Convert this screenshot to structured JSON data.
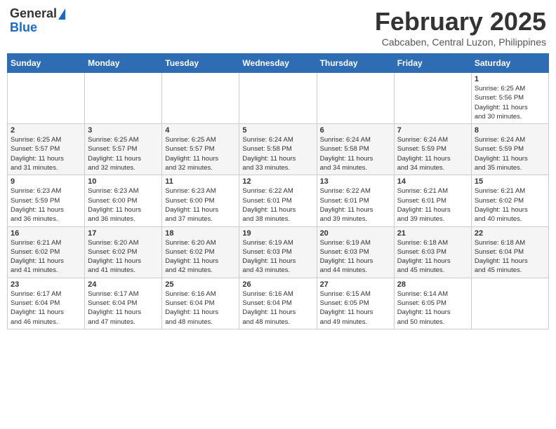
{
  "header": {
    "logo_general": "General",
    "logo_blue": "Blue",
    "month": "February 2025",
    "location": "Cabcaben, Central Luzon, Philippines"
  },
  "days_of_week": [
    "Sunday",
    "Monday",
    "Tuesday",
    "Wednesday",
    "Thursday",
    "Friday",
    "Saturday"
  ],
  "weeks": [
    [
      {
        "day": "",
        "info": ""
      },
      {
        "day": "",
        "info": ""
      },
      {
        "day": "",
        "info": ""
      },
      {
        "day": "",
        "info": ""
      },
      {
        "day": "",
        "info": ""
      },
      {
        "day": "",
        "info": ""
      },
      {
        "day": "1",
        "info": "Sunrise: 6:25 AM\nSunset: 5:56 PM\nDaylight: 11 hours\nand 30 minutes."
      }
    ],
    [
      {
        "day": "2",
        "info": "Sunrise: 6:25 AM\nSunset: 5:57 PM\nDaylight: 11 hours\nand 31 minutes."
      },
      {
        "day": "3",
        "info": "Sunrise: 6:25 AM\nSunset: 5:57 PM\nDaylight: 11 hours\nand 32 minutes."
      },
      {
        "day": "4",
        "info": "Sunrise: 6:25 AM\nSunset: 5:57 PM\nDaylight: 11 hours\nand 32 minutes."
      },
      {
        "day": "5",
        "info": "Sunrise: 6:24 AM\nSunset: 5:58 PM\nDaylight: 11 hours\nand 33 minutes."
      },
      {
        "day": "6",
        "info": "Sunrise: 6:24 AM\nSunset: 5:58 PM\nDaylight: 11 hours\nand 34 minutes."
      },
      {
        "day": "7",
        "info": "Sunrise: 6:24 AM\nSunset: 5:59 PM\nDaylight: 11 hours\nand 34 minutes."
      },
      {
        "day": "8",
        "info": "Sunrise: 6:24 AM\nSunset: 5:59 PM\nDaylight: 11 hours\nand 35 minutes."
      }
    ],
    [
      {
        "day": "9",
        "info": "Sunrise: 6:23 AM\nSunset: 5:59 PM\nDaylight: 11 hours\nand 36 minutes."
      },
      {
        "day": "10",
        "info": "Sunrise: 6:23 AM\nSunset: 6:00 PM\nDaylight: 11 hours\nand 36 minutes."
      },
      {
        "day": "11",
        "info": "Sunrise: 6:23 AM\nSunset: 6:00 PM\nDaylight: 11 hours\nand 37 minutes."
      },
      {
        "day": "12",
        "info": "Sunrise: 6:22 AM\nSunset: 6:01 PM\nDaylight: 11 hours\nand 38 minutes."
      },
      {
        "day": "13",
        "info": "Sunrise: 6:22 AM\nSunset: 6:01 PM\nDaylight: 11 hours\nand 39 minutes."
      },
      {
        "day": "14",
        "info": "Sunrise: 6:21 AM\nSunset: 6:01 PM\nDaylight: 11 hours\nand 39 minutes."
      },
      {
        "day": "15",
        "info": "Sunrise: 6:21 AM\nSunset: 6:02 PM\nDaylight: 11 hours\nand 40 minutes."
      }
    ],
    [
      {
        "day": "16",
        "info": "Sunrise: 6:21 AM\nSunset: 6:02 PM\nDaylight: 11 hours\nand 41 minutes."
      },
      {
        "day": "17",
        "info": "Sunrise: 6:20 AM\nSunset: 6:02 PM\nDaylight: 11 hours\nand 41 minutes."
      },
      {
        "day": "18",
        "info": "Sunrise: 6:20 AM\nSunset: 6:02 PM\nDaylight: 11 hours\nand 42 minutes."
      },
      {
        "day": "19",
        "info": "Sunrise: 6:19 AM\nSunset: 6:03 PM\nDaylight: 11 hours\nand 43 minutes."
      },
      {
        "day": "20",
        "info": "Sunrise: 6:19 AM\nSunset: 6:03 PM\nDaylight: 11 hours\nand 44 minutes."
      },
      {
        "day": "21",
        "info": "Sunrise: 6:18 AM\nSunset: 6:03 PM\nDaylight: 11 hours\nand 45 minutes."
      },
      {
        "day": "22",
        "info": "Sunrise: 6:18 AM\nSunset: 6:04 PM\nDaylight: 11 hours\nand 45 minutes."
      }
    ],
    [
      {
        "day": "23",
        "info": "Sunrise: 6:17 AM\nSunset: 6:04 PM\nDaylight: 11 hours\nand 46 minutes."
      },
      {
        "day": "24",
        "info": "Sunrise: 6:17 AM\nSunset: 6:04 PM\nDaylight: 11 hours\nand 47 minutes."
      },
      {
        "day": "25",
        "info": "Sunrise: 6:16 AM\nSunset: 6:04 PM\nDaylight: 11 hours\nand 48 minutes."
      },
      {
        "day": "26",
        "info": "Sunrise: 6:16 AM\nSunset: 6:04 PM\nDaylight: 11 hours\nand 48 minutes."
      },
      {
        "day": "27",
        "info": "Sunrise: 6:15 AM\nSunset: 6:05 PM\nDaylight: 11 hours\nand 49 minutes."
      },
      {
        "day": "28",
        "info": "Sunrise: 6:14 AM\nSunset: 6:05 PM\nDaylight: 11 hours\nand 50 minutes."
      },
      {
        "day": "",
        "info": ""
      }
    ]
  ]
}
